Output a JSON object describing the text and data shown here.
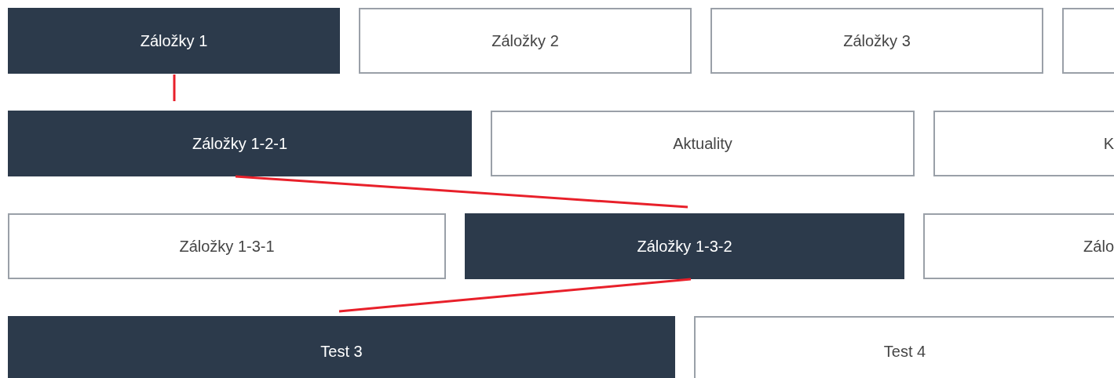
{
  "levels": [
    {
      "tabs": [
        {
          "label": "Záložky 1",
          "selected": true
        },
        {
          "label": "Záložky 2",
          "selected": false
        },
        {
          "label": "Záložky 3",
          "selected": false
        },
        {
          "selected": false
        }
      ]
    },
    {
      "tabs": [
        {
          "label": "Záložky 1-2-1",
          "selected": true
        },
        {
          "label": "Aktuality",
          "selected": false
        },
        {
          "label": "K",
          "selected": false
        }
      ]
    },
    {
      "tabs": [
        {
          "label": "Záložky 1-3-1",
          "selected": false
        },
        {
          "label": "Záložky 1-3-2",
          "selected": true
        },
        {
          "label": "Zálo",
          "selected": false
        }
      ]
    },
    {
      "tabs": [
        {
          "label": "Test 3",
          "selected": true
        },
        {
          "label": "Test 4",
          "selected": false
        }
      ]
    }
  ]
}
